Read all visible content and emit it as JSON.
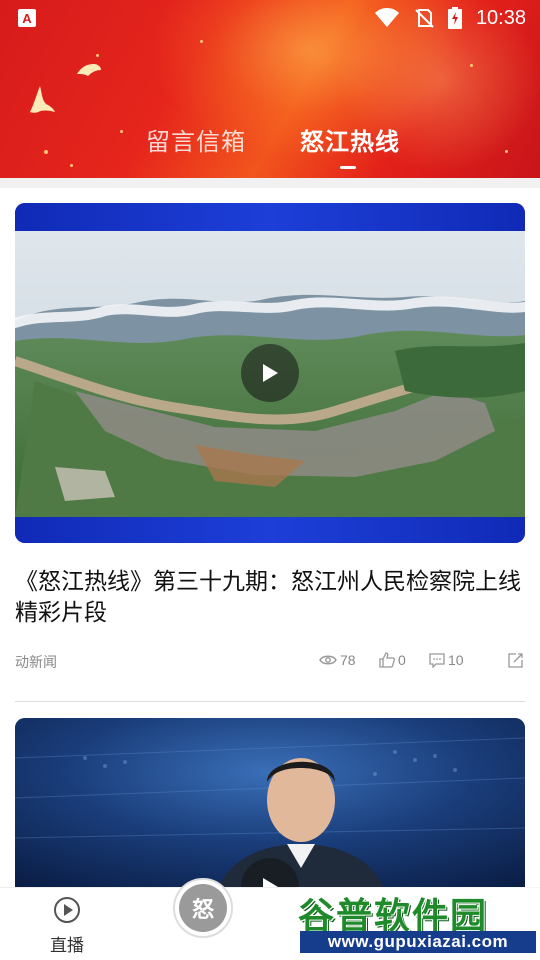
{
  "status_bar": {
    "app_icon_letter": "A",
    "time": "10:38"
  },
  "tabs": [
    {
      "label": "留言信箱",
      "active": false
    },
    {
      "label": "怒江热线",
      "active": true
    }
  ],
  "articles": [
    {
      "title": "《怒江热线》第三十九期：怒江州人民检察院上线精彩片段",
      "source": "动新闻",
      "views": "78",
      "likes": "0",
      "comments": "10"
    }
  ],
  "bottom_nav": {
    "live_label": "直播",
    "center_badge": "怒"
  },
  "watermark": {
    "title": "谷普软件园",
    "url": "www.gupuxiazai.com"
  },
  "colors": {
    "header_red": "#e3201a",
    "accent_gold": "#ffe08a",
    "video_frame_blue": "#1534c8",
    "watermark_green": "#1e8a2a",
    "watermark_blue": "#163c8c"
  }
}
